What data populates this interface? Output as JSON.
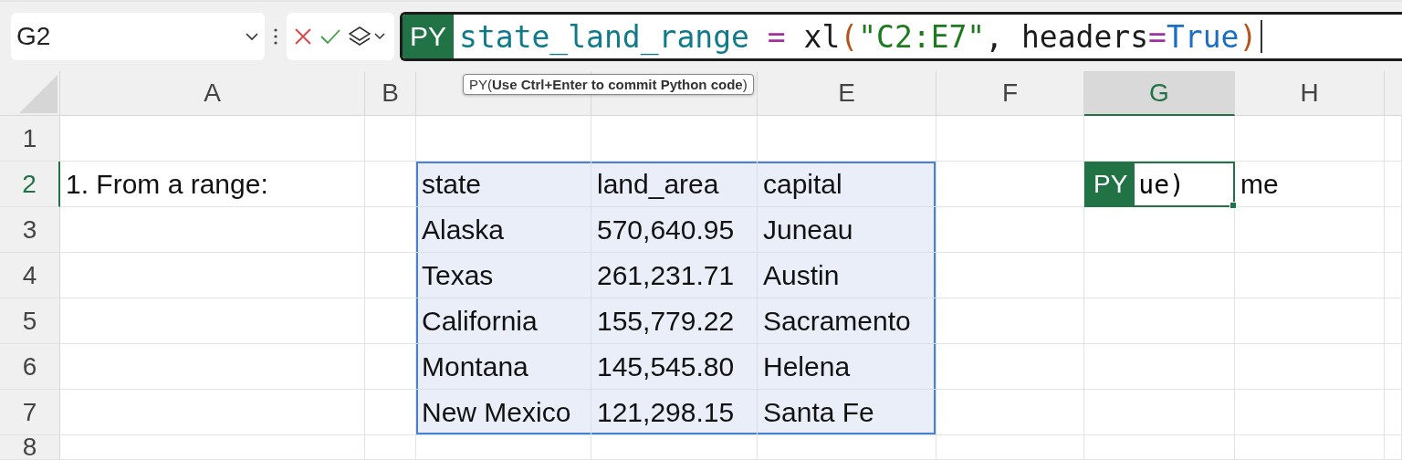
{
  "name_box": {
    "value": "G2"
  },
  "formula_bar": {
    "badge": "PY",
    "tokens": [
      {
        "text": "state_land_range",
        "kind": "variable"
      },
      {
        "text": " =",
        "kind": "operator"
      },
      {
        "text": " xl",
        "kind": "plain"
      },
      {
        "text": "(",
        "kind": "paren"
      },
      {
        "text": "\"C2:E7\"",
        "kind": "string"
      },
      {
        "text": ", headers",
        "kind": "plain"
      },
      {
        "text": "=",
        "kind": "operator"
      },
      {
        "text": "True",
        "kind": "keyword"
      },
      {
        "text": ")",
        "kind": "paren"
      }
    ]
  },
  "tooltip": "PY(**Use Ctrl+Enter to commit Python code**)",
  "columns": [
    {
      "label": "A",
      "selected": false
    },
    {
      "label": "B",
      "selected": false
    },
    {
      "selected": false
    },
    {
      "selected": false
    },
    {
      "label": "E",
      "selected": false
    },
    {
      "label": "F",
      "selected": false
    },
    {
      "label": "G",
      "selected": true
    },
    {
      "label": "H",
      "selected": false
    }
  ],
  "rows": [
    {
      "label": "1",
      "selected": false,
      "cells": [
        null,
        null,
        null,
        null,
        null,
        null,
        null,
        null
      ]
    },
    {
      "label": "2",
      "selected": true,
      "cells": [
        {
          "kind": "text",
          "text": "1. From a range:"
        },
        null,
        {
          "kind": "text",
          "text": "state",
          "selected": true
        },
        {
          "kind": "text",
          "text": "land_area",
          "selected": true
        },
        {
          "kind": "text",
          "text": "capital",
          "selected": true
        },
        null,
        {
          "kind": "python",
          "badge": "PY",
          "text": "ue)"
        },
        {
          "kind": "text",
          "text": "me"
        }
      ]
    },
    {
      "label": "3",
      "selected": false,
      "cells": [
        null,
        null,
        {
          "kind": "text",
          "text": "Alaska",
          "selected": true
        },
        {
          "kind": "text",
          "text": "570,640.95",
          "selected": true
        },
        {
          "kind": "text",
          "text": "Juneau",
          "selected": true
        },
        null,
        null,
        null
      ]
    },
    {
      "label": "4",
      "selected": false,
      "cells": [
        null,
        null,
        {
          "kind": "text",
          "text": "Texas",
          "selected": true
        },
        {
          "kind": "text",
          "text": "261,231.71",
          "selected": true
        },
        {
          "kind": "text",
          "text": "Austin",
          "selected": true
        },
        null,
        null,
        null
      ]
    },
    {
      "label": "5",
      "selected": false,
      "cells": [
        null,
        null,
        {
          "kind": "text",
          "text": "California",
          "selected": true
        },
        {
          "kind": "text",
          "text": "155,779.22",
          "selected": true
        },
        {
          "kind": "text",
          "text": "Sacramento",
          "selected": true
        },
        null,
        null,
        null
      ]
    },
    {
      "label": "6",
      "selected": false,
      "cells": [
        null,
        null,
        {
          "kind": "text",
          "text": "Montana",
          "selected": true
        },
        {
          "kind": "text",
          "text": "145,545.80",
          "selected": true
        },
        {
          "kind": "text",
          "text": "Helena",
          "selected": true
        },
        null,
        null,
        null
      ]
    },
    {
      "label": "7",
      "selected": false,
      "cells": [
        null,
        null,
        {
          "kind": "text",
          "text": "New Mexico",
          "selected": true
        },
        {
          "kind": "text",
          "text": "121,298.15",
          "selected": true
        },
        {
          "kind": "text",
          "text": "Santa Fe",
          "selected": true
        },
        null,
        null,
        null
      ]
    },
    {
      "label": "8",
      "selected": false,
      "cells": [
        null,
        null,
        null,
        null,
        null,
        null,
        null,
        null
      ]
    }
  ]
}
